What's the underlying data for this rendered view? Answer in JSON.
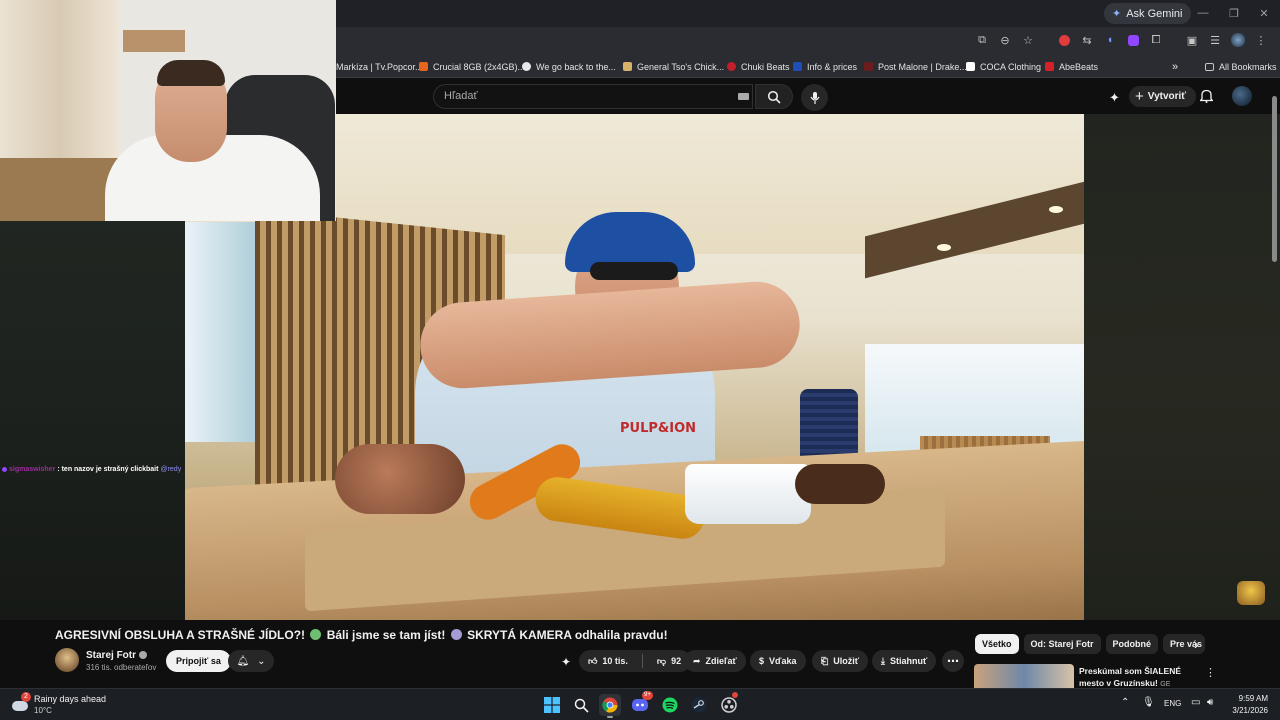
{
  "browser": {
    "gemini_label": "Ask Gemini",
    "bookmarks": [
      {
        "label": "Markíza | Tv.Popcor...",
        "color": "#2f6fdd"
      },
      {
        "label": "Crucial 8GB (2x4GB)...",
        "color": "#e5651c"
      },
      {
        "label": "We go back to the...",
        "color": "#e8e8e8"
      },
      {
        "label": "General Tso's Chick...",
        "color": "#d8b26a"
      },
      {
        "label": "Chuki Beats",
        "color": "#c21e2b"
      },
      {
        "label": "Info & prices",
        "color": "#1e4fb8"
      },
      {
        "label": "Post Malone | Drake...",
        "color": "#6b1d1d"
      },
      {
        "label": "COCA Clothing",
        "color": "#ffffff"
      },
      {
        "label": "AbeBeats",
        "color": "#d6202a"
      }
    ],
    "all_bookmarks": "All Bookmarks",
    "overflow_glyph": "»"
  },
  "youtube": {
    "search_placeholder": "Hľadať",
    "create_label": "Vytvoriť",
    "chat": {
      "user": "sigmaswisher",
      "message": ": ten nazov je strašný clickbait",
      "mention": "@redy"
    },
    "video": {
      "title_part1": "AGRESIVNÍ OBSLUHA A STRAŠNÉ JÍDLO?!",
      "title_part2": "Báli jsme se tam jíst!",
      "title_part3": "SKRYTÁ KAMERA odhalila pravdu!",
      "shirt_text": "PULP&ION",
      "channel_name": "Starej Fotr",
      "subscribers": "316 tis. odberateľov",
      "join_label": "Pripojiť sa",
      "likes": "10 tis.",
      "dislikes": "92",
      "share_label": "Zdieľať",
      "thanks_label": "Vďaka",
      "save_label": "Uložiť",
      "download_label": "Stiahnuť"
    },
    "chips": [
      "Všetko",
      "Od: Starej Fotr",
      "Podobné",
      "Pre vás"
    ],
    "recommended": {
      "title": "Preskúmal som ŠIALENÉ mesto v Gruzínsku!",
      "suffix": "GE"
    }
  },
  "taskbar": {
    "weather_badge": "2",
    "weather_title": "Rainy days ahead",
    "weather_temp": "10°C",
    "discord_badge": "9+",
    "language": "ENG",
    "time": "9:59 AM",
    "date": "3/21/2026"
  },
  "colors": {
    "accent_red": "#ff0033",
    "youtube_bg": "#0f0f0f",
    "chip_active_bg": "#f1f1f1"
  }
}
